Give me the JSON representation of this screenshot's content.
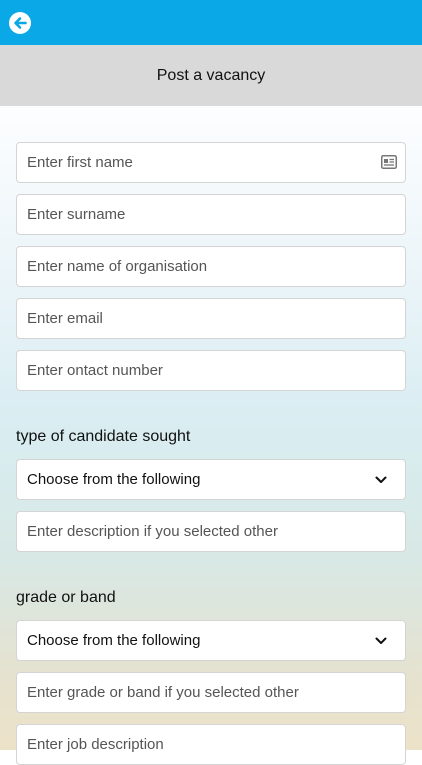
{
  "header": {
    "back_icon": "back-arrow-circle-icon",
    "title": "Post a vacancy",
    "bar_color": "#0aa8e6"
  },
  "form": {
    "first_name_placeholder": "Enter first name",
    "surname_placeholder": "Enter surname",
    "organisation_placeholder": "Enter name of organisation",
    "email_placeholder": "Enter email",
    "contact_placeholder": "Enter ontact number",
    "candidate_section_label": "type of candidate sought",
    "candidate_select_value": "Choose from the following",
    "candidate_other_placeholder": "Enter description if you selected other",
    "grade_section_label": "grade or band",
    "grade_select_value": "Choose from the following",
    "grade_other_placeholder": "Enter grade or band if you selected other",
    "job_description_placeholder": "Enter job description"
  }
}
